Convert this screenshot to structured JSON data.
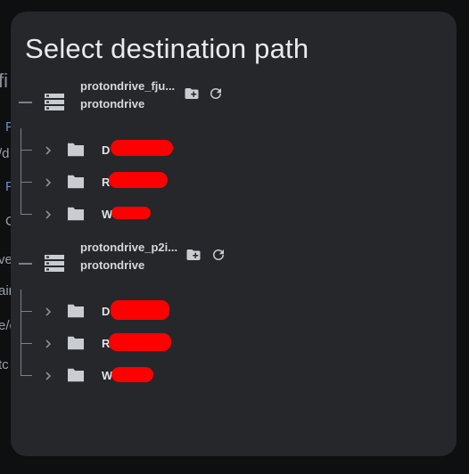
{
  "background": {
    "fragments": [
      "fi",
      "P",
      "/d",
      "P",
      "C",
      "ve",
      "ain",
      "e/c",
      "tc"
    ]
  },
  "dialog": {
    "title": "Select destination path",
    "roots": [
      {
        "name": "protondrive_fju...",
        "type": "protondrive",
        "actions": {
          "new_folder_icon": "create-new-folder-icon",
          "refresh_icon": "refresh-icon"
        },
        "children": [
          {
            "label": "D",
            "redacted": true
          },
          {
            "label": "R",
            "redacted": true
          },
          {
            "label": "W",
            "redacted": true
          }
        ]
      },
      {
        "name": "protondrive_p2i...",
        "type": "protondrive",
        "actions": {
          "new_folder_icon": "create-new-folder-icon",
          "refresh_icon": "refresh-icon"
        },
        "children": [
          {
            "label": "D",
            "redacted": true
          },
          {
            "label": "R",
            "redacted": true
          },
          {
            "label": "W",
            "redacted": true
          }
        ]
      }
    ]
  },
  "colors": {
    "backdrop": "#0e0f11",
    "dialog_bg": "#25272b",
    "title_text": "#e9eaec",
    "tree_line": "#7c8188",
    "icon": "#c9ccd1",
    "redaction": "#ff0000"
  }
}
